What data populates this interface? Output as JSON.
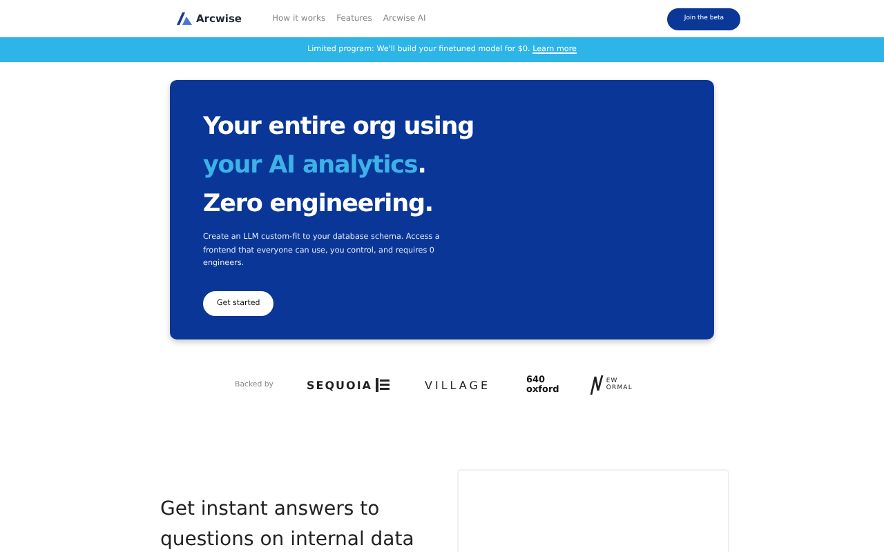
{
  "nav": {
    "brand": "Arcwise",
    "links": [
      "How it works",
      "Features",
      "Arcwise AI"
    ],
    "cta": "Join the beta"
  },
  "banner": {
    "text": "Limited program: We'll build your finetuned model for $0.",
    "link": "Learn more"
  },
  "hero": {
    "headline": [
      [
        {
          "text": "Your entire org using",
          "accent": false
        }
      ],
      [
        {
          "text": "your AI analytics",
          "accent": true
        },
        {
          "text": ".",
          "accent": false
        }
      ],
      [
        {
          "text": "Zero engineering.",
          "accent": false
        }
      ]
    ],
    "description": "Create an LLM custom-fit to your database schema. Access a frontend that everyone can use, you control, and requires 0 engineers.",
    "button": "Get started"
  },
  "backers": {
    "label": "Backed by",
    "logos": [
      {
        "kind": "sequoia",
        "text": "SEQUOIA"
      },
      {
        "kind": "village",
        "text": "VILLAGE"
      },
      {
        "kind": "oxford",
        "text": "640\noxford"
      },
      {
        "kind": "newnormal",
        "text": "EW\nORMAL"
      }
    ]
  },
  "section": {
    "heading": "Get instant answers to questions on internal data"
  }
}
